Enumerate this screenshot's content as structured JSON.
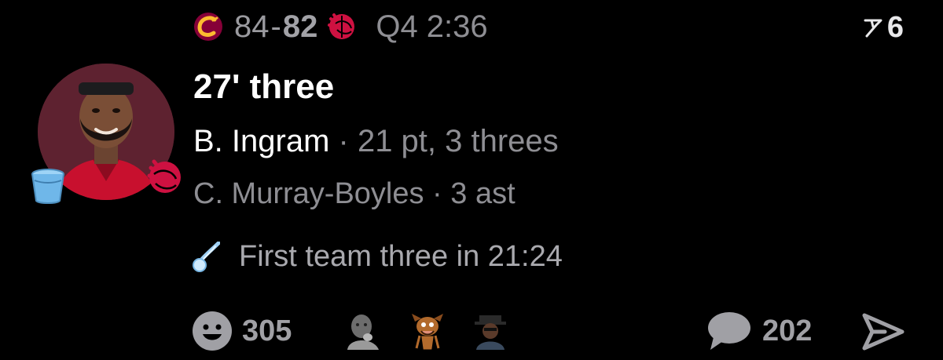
{
  "header": {
    "away_team_icon": "cavaliers-logo-icon",
    "home_team_icon": "raptors-logo-icon",
    "away_score": "84",
    "score_separator": "-",
    "home_score": "82",
    "game_clock": "Q4 2:36",
    "follow_icon": "flag-icon",
    "follow_count": "6"
  },
  "player": {
    "avatar_icon": "player-avatar",
    "badge_icon": "bucket-icon",
    "team_badge_icon": "raptors-badge-icon"
  },
  "play": {
    "title": "27' three",
    "scorer_name": "B. Ingram",
    "scorer_stats": " · 21 pt, 3 threes",
    "assist_text": "C. Murray-Boyles · 3 ast",
    "note_icon": "comet-icon",
    "note_text": "First team three in 21:24"
  },
  "footer": {
    "reaction_icon": "smiley-icon",
    "reaction_count": "305",
    "reactors": [
      "reactor-avatar-1",
      "reactor-avatar-2",
      "reactor-avatar-3"
    ],
    "comment_icon": "comment-bubble-icon",
    "comment_count": "202",
    "share_icon": "send-icon"
  },
  "colors": {
    "background": "#000000",
    "primary_text": "#ffffff",
    "secondary_text": "#8e8e93",
    "raptors_red": "#ce1141",
    "cavs_wine": "#860038",
    "cavs_gold": "#fdbb30",
    "accent_blue": "#6fb7e9"
  }
}
